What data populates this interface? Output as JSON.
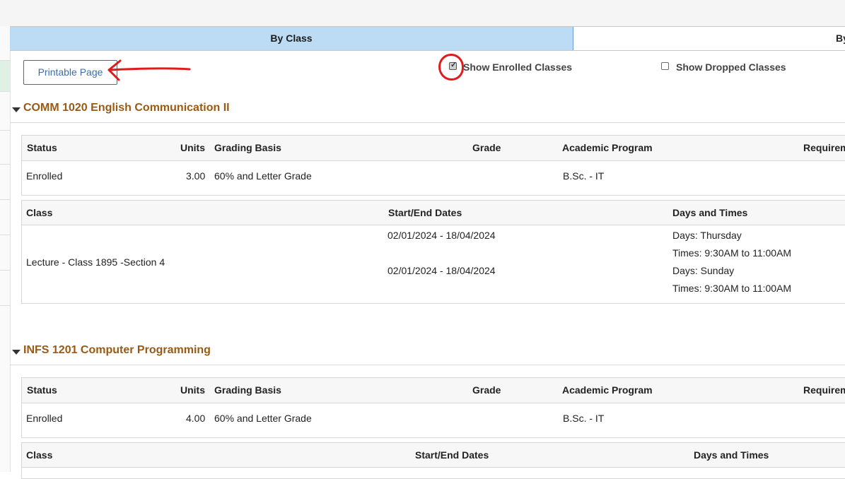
{
  "tabs": {
    "active": "By Class",
    "inactive": "By"
  },
  "toolbar": {
    "printable_label": "Printable Page",
    "show_enrolled_label": "Show Enrolled Classes",
    "show_enrolled_checked": true,
    "show_dropped_label": "Show Dropped Classes",
    "show_dropped_checked": false
  },
  "annotation_color": "#e01b1b",
  "title_color": "#9a5a14",
  "courses": [
    {
      "title": "COMM 1020 English Communication II",
      "summary_headers": {
        "status": "Status",
        "units": "Units",
        "grading": "Grading Basis",
        "grade": "Grade",
        "program": "Academic Program",
        "req": "Requirem"
      },
      "summary": {
        "status": "Enrolled",
        "units": "3.00",
        "grading": "60% and Letter Grade",
        "grade": "",
        "program": "B.Sc. - IT"
      },
      "detail_headers": {
        "class": "Class",
        "dates": "Start/End Dates",
        "days": "Days and Times"
      },
      "class_name": "Lecture - Class 1895 -Section 4",
      "meetings": [
        {
          "dates": "02/01/2024 - 18/04/2024",
          "days": "Days: Thursday",
          "times": "Times: 9:30AM to 11:00AM"
        },
        {
          "dates": "02/01/2024 - 18/04/2024",
          "days": "Days: Sunday",
          "times": "Times: 9:30AM to 11:00AM"
        }
      ]
    },
    {
      "title": "INFS 1201 Computer Programming",
      "summary_headers": {
        "status": "Status",
        "units": "Units",
        "grading": "Grading Basis",
        "grade": "Grade",
        "program": "Academic Program",
        "req": "Requirem"
      },
      "summary": {
        "status": "Enrolled",
        "units": "4.00",
        "grading": "60% and Letter Grade",
        "grade": "",
        "program": "B.Sc. - IT"
      },
      "detail_headers": {
        "class": "Class",
        "dates": "Start/End Dates",
        "days": "Days and Times"
      }
    }
  ]
}
